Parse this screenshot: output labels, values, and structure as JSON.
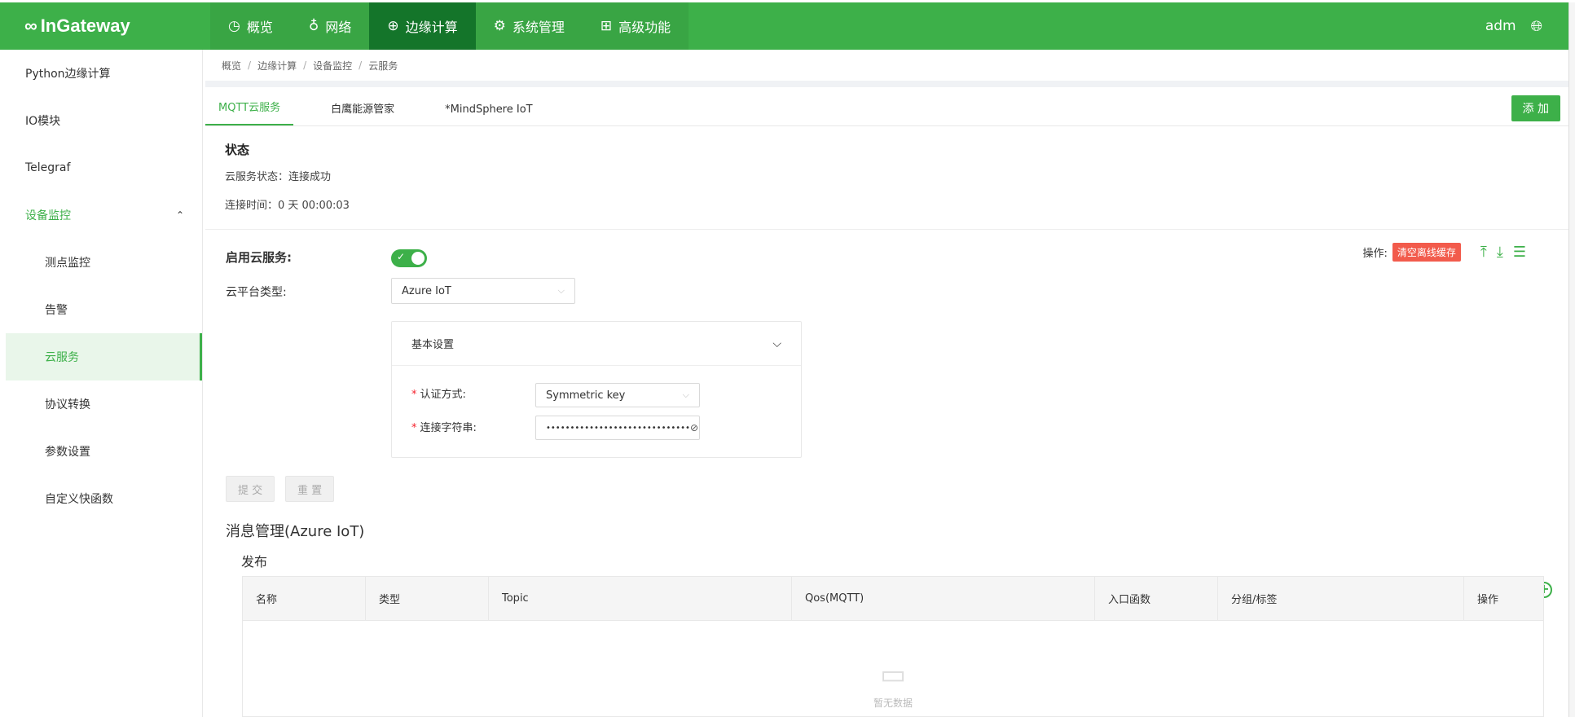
{
  "app": {
    "logo_text": "InGateway",
    "user": "adm"
  },
  "topnav": [
    {
      "label": "概览",
      "icon": "dashboard-icon"
    },
    {
      "label": "网络",
      "icon": "network-icon"
    },
    {
      "label": "边缘计算",
      "icon": "cloud-compute-icon",
      "active": true
    },
    {
      "label": "系统管理",
      "icon": "gear-icon"
    },
    {
      "label": "高级功能",
      "icon": "grid-icon"
    }
  ],
  "sidebar": {
    "items": [
      {
        "label": "Python边缘计算"
      },
      {
        "label": "IO模块"
      },
      {
        "label": "Telegraf"
      },
      {
        "label": "设备监控",
        "expanded": true
      },
      {
        "label": "测点监控"
      },
      {
        "label": "告警"
      },
      {
        "label": "云服务",
        "selected": true
      },
      {
        "label": "协议转换"
      },
      {
        "label": "参数设置"
      },
      {
        "label": "自定义快函数"
      }
    ]
  },
  "breadcrumb": [
    "概览",
    "边缘计算",
    "设备监控",
    "云服务"
  ],
  "tabs": [
    "MQTT云服务",
    "白鹰能源管家",
    "*MindSphere IoT"
  ],
  "add_label": "添 加",
  "status": {
    "title": "状态",
    "service_status": "云服务状态：连接成功",
    "connect_time": "连接时间：0 天 00:00:03"
  },
  "form": {
    "enable_label": "启用云服务:",
    "enable_value": true,
    "platform_label": "云平台类型:",
    "platform_value": "Azure IoT",
    "panel_title": "基本设置",
    "auth_label": "认证方式:",
    "auth_value": "Symmetric key",
    "conn_label": "连接字符串:",
    "conn_value": "••••••••••••••••••••••••••••••",
    "submit_label": "提 交",
    "reset_label": "重 置"
  },
  "ops": {
    "label": "操作:",
    "clear_label": "清空离线缓存"
  },
  "messages": {
    "title": "消息管理(Azure IoT)",
    "publish_title": "发布",
    "columns": [
      "名称",
      "类型",
      "Topic",
      "Qos(MQTT)",
      "入口函数",
      "分组/标签",
      "操作"
    ],
    "empty_text": "暂无数据"
  },
  "colors": {
    "accent": "#3db049",
    "nav_active": "#14752a",
    "danger": "#f25b4c"
  }
}
